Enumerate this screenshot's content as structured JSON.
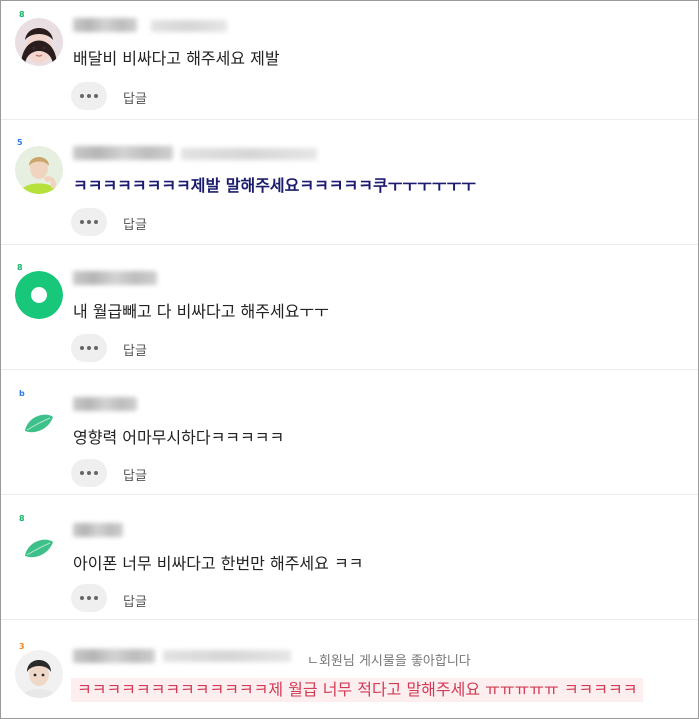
{
  "comments": [
    {
      "text": "배달비 비싸다고 해주세요 제발",
      "reply_label": "답글",
      "level": "8"
    },
    {
      "text": "ㅋㅋㅋㅋㅋㅋㅋㅋ제발 말해주세요ㅋㅋㅋㅋㅋ쿠ㅜㅜㅜㅜㅜㅜ",
      "reply_label": "답글",
      "level": "5"
    },
    {
      "text": "내 월급빼고 다 비싸다고 해주세요ㅜㅜ",
      "reply_label": "답글",
      "level": "8"
    },
    {
      "text": "영향력 어마무시하다ㅋㅋㅋㅋㅋ",
      "reply_label": "답글",
      "level": "b"
    },
    {
      "text": "아이폰 너무 비싸다고 한번만 해주세요 ㅋㅋ",
      "reply_label": "답글",
      "level": "8"
    },
    {
      "text": "ㅋㅋㅋㅋㅋㅋㅋㅋㅋㅋㅋㅋㅋ제 월급 너무 적다고 말해주세요 ㅠㅠㅠㅠㅠ ㅋㅋㅋㅋㅋ",
      "level": "3",
      "liked_note": "ㄴ회원님 게시물을 좋아합니다"
    }
  ],
  "colors": {
    "bold_text": "#1c1c6e",
    "highlight_bg": "#fdeff0",
    "highlight_text": "#d23b55",
    "leaf_green": "#3ec08a",
    "ring_green": "#19c77b"
  }
}
